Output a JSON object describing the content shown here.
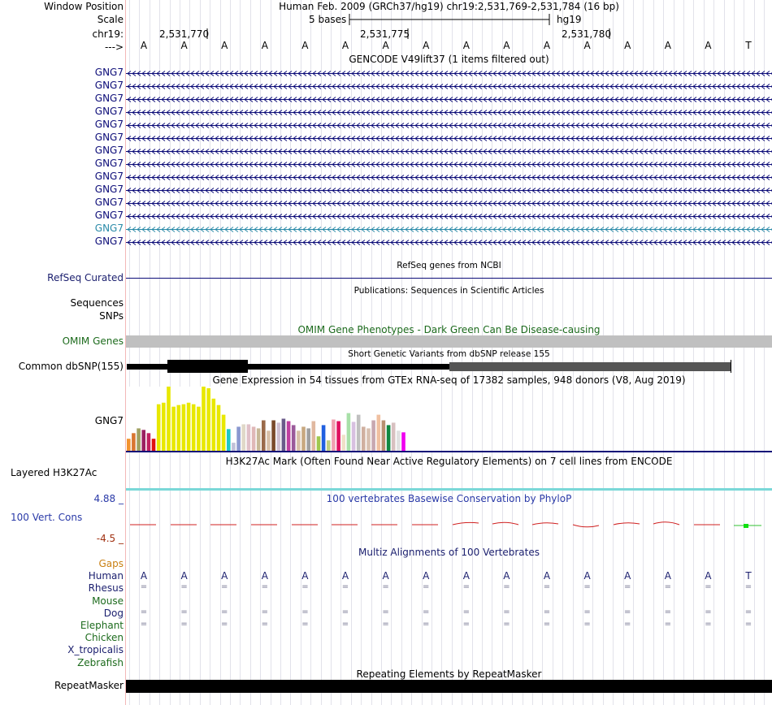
{
  "header": {
    "window_position_label": "Window Position",
    "scale_label": "Scale",
    "chrom_label": "chr19:",
    "strand_label": "--->",
    "title": "Human Feb. 2009 (GRCh37/hg19)   chr19:2,531,769-2,531,784 (16 bp)",
    "scale_text": "5 bases",
    "assembly": "hg19",
    "coords": [
      "2,531,770",
      "2,531,775",
      "2,531,780"
    ]
  },
  "sequence": [
    "A",
    "A",
    "A",
    "A",
    "A",
    "A",
    "A",
    "A",
    "A",
    "A",
    "A",
    "A",
    "A",
    "A",
    "A",
    "T"
  ],
  "gencode": {
    "title": "GENCODE V49lift37 (1 items filtered out)",
    "genes": [
      "GNG7",
      "GNG7",
      "GNG7",
      "GNG7",
      "GNG7",
      "GNG7",
      "GNG7",
      "GNG7",
      "GNG7",
      "GNG7",
      "GNG7",
      "GNG7",
      "GNG7",
      "GNG7"
    ],
    "highlight_index": 12,
    "colors": {
      "normal": "#0c0c78",
      "highlight": "#2a8aa8"
    }
  },
  "refseq": {
    "title": "RefSeq genes from NCBI",
    "label": "RefSeq Curated"
  },
  "publications": {
    "title": "Publications: Sequences in Scientific Articles",
    "labels": [
      "Sequences",
      "SNPs"
    ]
  },
  "omim": {
    "title": "OMIM Gene Phenotypes - Dark Green Can Be Disease-causing",
    "label": "OMIM Genes"
  },
  "dbsnp": {
    "title": "Short Genetic Variants from dbSNP release 155",
    "label": "Common dbSNP(155)"
  },
  "gtex": {
    "title": "Gene Expression in 54 tissues from GTEx RNA-seq of 17382 samples, 948 donors (V8, Aug 2019)",
    "label": "GNG7"
  },
  "chart_data": {
    "type": "bar",
    "values": [
      15,
      22,
      28,
      26,
      22,
      15,
      58,
      60,
      80,
      55,
      57,
      58,
      60,
      58,
      55,
      80,
      78,
      65,
      57,
      45,
      27,
      10,
      30,
      33,
      33,
      30,
      28,
      38,
      25,
      38,
      35,
      40,
      37,
      32,
      25,
      30,
      28,
      37,
      18,
      32,
      13,
      39,
      37,
      20,
      47,
      36,
      45,
      30,
      28,
      38,
      45,
      38,
      32,
      35,
      25,
      23
    ],
    "colors": [
      "#f2922e",
      "#d97530",
      "#a0a060",
      "#9a2060",
      "#c02060",
      "#e01010",
      "#e8e800",
      "#e8e800",
      "#e8e800",
      "#e8e800",
      "#e8e800",
      "#e8e800",
      "#e8e800",
      "#e8e800",
      "#e8e800",
      "#e8e800",
      "#e8e800",
      "#e8e800",
      "#e8e800",
      "#e8e800",
      "#20c8c8",
      "#c0c0d8",
      "#8a98d0",
      "#e0d8c8",
      "#e0c0c8",
      "#e0b8b8",
      "#c8b898",
      "#9a6a4a",
      "#d8c0a8",
      "#7a4a2a",
      "#d0c0d0",
      "#6a5a8a",
      "#c040a0",
      "#9a5a9a",
      "#d8c0a8",
      "#c8a880",
      "#a0a0a0",
      "#e0b8a0",
      "#a0c850",
      "#2060e0",
      "#c0d080",
      "#f0a0b0",
      "#e01060",
      "#f0e0c8",
      "#a8e0a8",
      "#d8c0e0",
      "#c0c0c0",
      "#d0b0a0",
      "#d8c0b0",
      "#c8a8b0",
      "#f0c0a0",
      "#b89070",
      "#108840",
      "#d8c0c0",
      "#e0e0e0",
      "#f000f0"
    ],
    "ylim": [
      0,
      80
    ]
  },
  "h3k27ac": {
    "title": "H3K27Ac Mark (Often Found Near Active Regulatory Elements) on 7 cell lines from ENCODE",
    "label": "Layered H3K27Ac"
  },
  "conservation": {
    "title": "100 vertebrates Basewise Conservation by PhyloP",
    "label": "100 Vert. Cons",
    "max": "4.88 _",
    "min": "-4.5 _"
  },
  "multiz": {
    "title": "Multiz Alignments of 100 Vertebrates",
    "species": [
      {
        "name": "Gaps",
        "color": "orange"
      },
      {
        "name": "Human",
        "color": "navy"
      },
      {
        "name": "Rhesus",
        "color": "navy"
      },
      {
        "name": "Mouse",
        "color": "green"
      },
      {
        "name": "Dog",
        "color": "navy"
      },
      {
        "name": "Elephant",
        "color": "green"
      },
      {
        "name": "Chicken",
        "color": "green"
      },
      {
        "name": "X_tropicalis",
        "color": "navy"
      },
      {
        "name": "Zebrafish",
        "color": "green"
      }
    ],
    "match_char": "="
  },
  "repeatmasker": {
    "title": "Repeating Elements by RepeatMasker",
    "label": "RepeatMasker"
  }
}
